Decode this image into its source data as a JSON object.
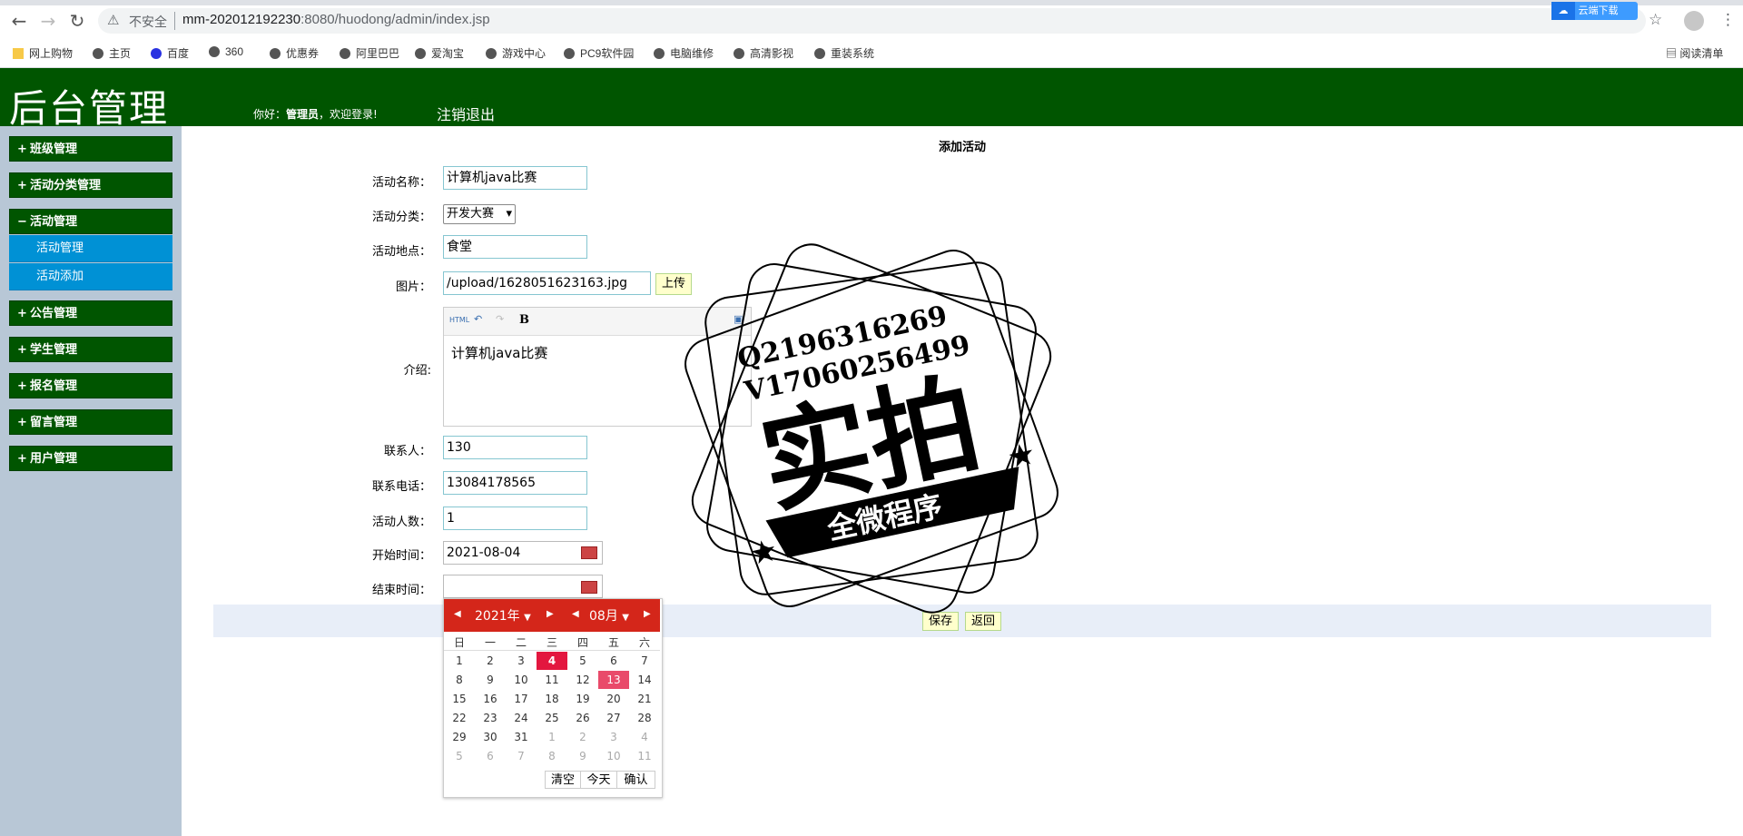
{
  "browser": {
    "insecure_label": "不安全",
    "url_host": "mm-202012192230",
    "url_rest": ":8080/huodong/admin/index.jsp",
    "extension_label": "云端下载",
    "reading_list": "阅读清单",
    "bookmarks": [
      "网上购物",
      "主页",
      "百度",
      "360",
      "优惠券",
      "阿里巴巴",
      "爱淘宝",
      "游戏中心",
      "PC9软件园",
      "电脑维修",
      "高清影视",
      "重装系统"
    ]
  },
  "header": {
    "title": "后台管理",
    "greeting_prefix": "你好：",
    "user": "管理员",
    "greeting_suffix": "，欢迎登录!",
    "logout": "注销退出"
  },
  "sidebar": {
    "menus": [
      {
        "sign": "+",
        "label": "班级管理"
      },
      {
        "sign": "+",
        "label": "活动分类管理"
      },
      {
        "sign": "−",
        "label": "活动管理"
      },
      {
        "sign": "+",
        "label": "公告管理"
      },
      {
        "sign": "+",
        "label": "学生管理"
      },
      {
        "sign": "+",
        "label": "报名管理"
      },
      {
        "sign": "+",
        "label": "留言管理"
      },
      {
        "sign": "+",
        "label": "用户管理"
      }
    ],
    "sub_items": [
      "活动管理",
      "活动添加"
    ]
  },
  "form": {
    "title": "添加活动",
    "fields": {
      "name": {
        "label": "活动名称：",
        "value": "计算机java比赛"
      },
      "category": {
        "label": "活动分类：",
        "value": "开发大赛"
      },
      "location": {
        "label": "活动地点：",
        "value": "食堂"
      },
      "image": {
        "label": "图片：",
        "value": "/upload/1628051623163.jpg",
        "upload_button": "上传"
      },
      "intro": {
        "label": "介绍:",
        "value": "计算机java比赛",
        "toolbar_html": "HTML",
        "toolbar_bold": "B"
      },
      "contact": {
        "label": "联系人：",
        "value": "130"
      },
      "phone": {
        "label": "联系电话：",
        "value": "13084178565"
      },
      "capacity": {
        "label": "活动人数：",
        "value": "1"
      },
      "start": {
        "label": "开始时间：",
        "value": "2021-08-04"
      },
      "end": {
        "label": "结束时间：",
        "value": ""
      }
    },
    "save_button": "保存",
    "back_button": "返回"
  },
  "calendar": {
    "year_label": "2021年",
    "month_label": "08月",
    "weekdays": [
      "日",
      "一",
      "二",
      "三",
      "四",
      "五",
      "六"
    ],
    "rows": [
      [
        "1",
        "2",
        "3",
        "4",
        "5",
        "6",
        "7"
      ],
      [
        "8",
        "9",
        "10",
        "11",
        "12",
        "13",
        "14"
      ],
      [
        "15",
        "16",
        "17",
        "18",
        "19",
        "20",
        "21"
      ],
      [
        "22",
        "23",
        "24",
        "25",
        "26",
        "27",
        "28"
      ],
      [
        "29",
        "30",
        "31",
        "1",
        "2",
        "3",
        "4"
      ],
      [
        "5",
        "6",
        "7",
        "8",
        "9",
        "10",
        "11"
      ]
    ],
    "selected_day": "4",
    "today": "13",
    "clear": "清空",
    "today_btn": "今天",
    "confirm": "确认"
  },
  "watermark": {
    "line1": "Q2196316269",
    "line2": "V17060256499",
    "big": "实拍",
    "banner": "全微程序"
  }
}
